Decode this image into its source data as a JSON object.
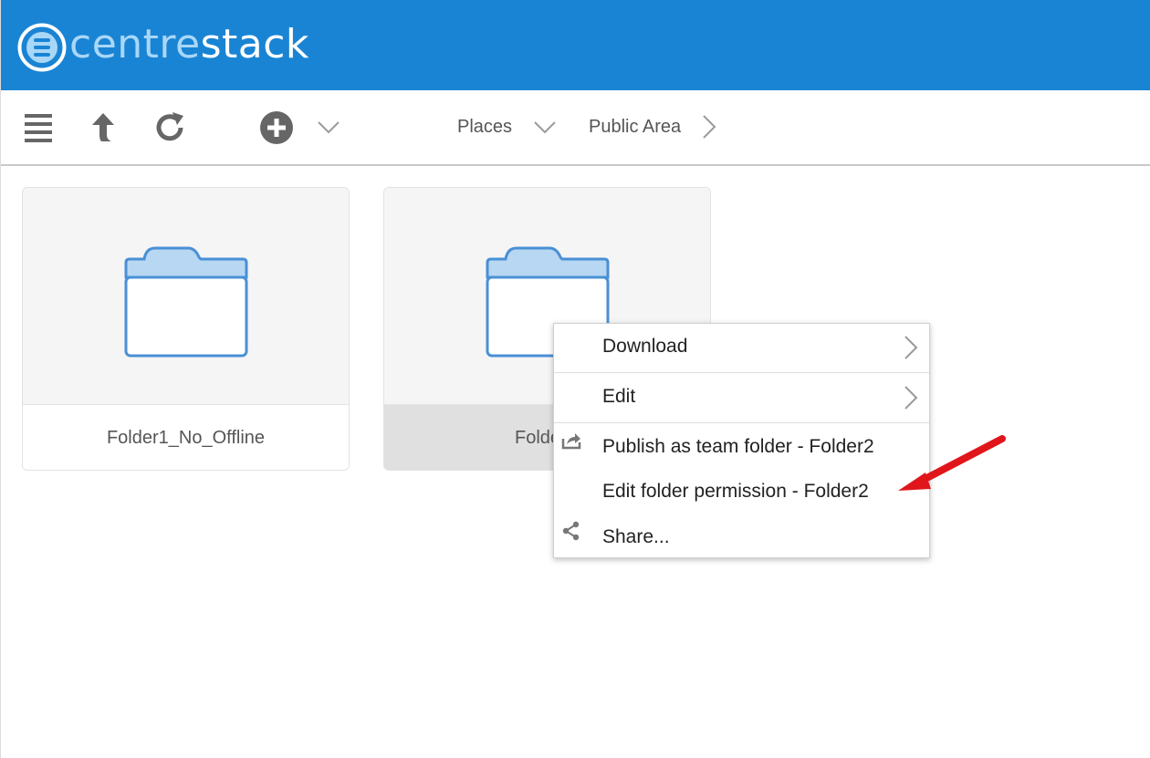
{
  "header": {
    "logo_light": "centre",
    "logo_bold": "stack",
    "bg_color": "#1a84d4"
  },
  "toolbar": {
    "menu_icon": "hamburger-menu-icon",
    "up_icon": "up-arrow-icon",
    "refresh_icon": "refresh-icon",
    "add_icon": "plus-circle-icon",
    "dropdown_icon": "chevron-down-icon",
    "breadcrumb": [
      {
        "label": "Places",
        "icon": "chevron-down-icon"
      },
      {
        "label": "Public Area",
        "icon": "chevron-right-icon"
      }
    ]
  },
  "tiles": [
    {
      "name": "Folder1_No_Offline",
      "icon": "folder-icon"
    },
    {
      "name": "Folde",
      "icon": "folder-icon",
      "selected": true
    }
  ],
  "context_menu": {
    "items": [
      {
        "label": "Download",
        "icon": "chevron-right-icon"
      },
      {
        "label": "Edit",
        "icon": "chevron-right-icon"
      },
      {
        "label": "Publish as team folder - Folder2",
        "icon": "publish-share-icon"
      },
      {
        "label": "Edit folder permission - Folder2"
      },
      {
        "label": "Share...",
        "icon": "share-icon"
      }
    ]
  },
  "annotation": {
    "icon": "red-arrow-icon",
    "color": "#e0161b"
  }
}
